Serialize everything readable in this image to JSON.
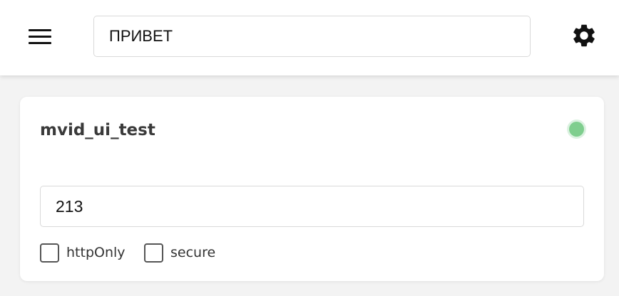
{
  "header": {
    "menu_icon": "hamburger-menu-icon",
    "search_value": "ПРИВЕТ",
    "settings_icon": "gear-icon"
  },
  "cookie": {
    "name": "mvid_ui_test",
    "status_color": "#7fce8e",
    "value": "213",
    "flags": {
      "httpOnly_label": "httpOnly",
      "httpOnly_checked": false,
      "secure_label": "secure",
      "secure_checked": false
    }
  }
}
